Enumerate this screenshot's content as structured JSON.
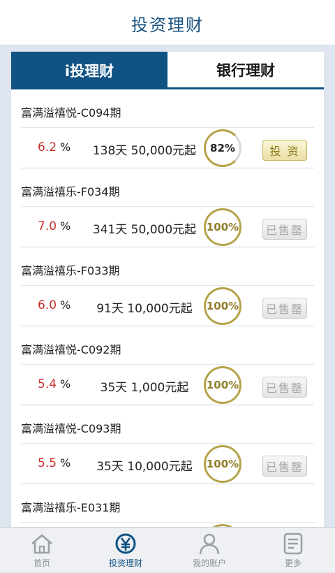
{
  "header": {
    "title": "投资理财"
  },
  "tabs": [
    {
      "label": "i投理财",
      "active": true
    },
    {
      "label": "银行理财",
      "active": false
    }
  ],
  "products": [
    {
      "name": "富满溢禧悦-C094期",
      "rate": "6.2",
      "rate_unit": "%",
      "terms": "138天 50,000元起",
      "progress": "82%",
      "action": "投 资",
      "status": "invest"
    },
    {
      "name": "富满溢禧乐-F034期",
      "rate": "7.0",
      "rate_unit": "%",
      "terms": "341天 50,000元起",
      "progress": "100%",
      "action": "已售罄",
      "status": "soldout"
    },
    {
      "name": "富满溢禧乐-F033期",
      "rate": "6.0",
      "rate_unit": "%",
      "terms": "91天 10,000元起",
      "progress": "100%",
      "action": "已售罄",
      "status": "soldout"
    },
    {
      "name": "富满溢禧悦-C092期",
      "rate": "5.4",
      "rate_unit": "%",
      "terms": "35天 1,000元起",
      "progress": "100%",
      "action": "已售罄",
      "status": "soldout"
    },
    {
      "name": "富满溢禧悦-C093期",
      "rate": "5.5",
      "rate_unit": "%",
      "terms": "35天 10,000元起",
      "progress": "100%",
      "action": "已售罄",
      "status": "soldout"
    },
    {
      "name": "富满溢禧乐-E031期",
      "rate": "",
      "rate_unit": "",
      "terms": "",
      "progress": "",
      "action": "",
      "status": "partial"
    }
  ],
  "bottom_nav": [
    {
      "label": "首页",
      "icon": "home-icon",
      "active": false
    },
    {
      "label": "投资理财",
      "icon": "yen-icon",
      "active": true
    },
    {
      "label": "我的账户",
      "icon": "user-icon",
      "active": false
    },
    {
      "label": "更多",
      "icon": "more-icon",
      "active": false
    }
  ],
  "colors": {
    "brand": "#0f5283",
    "rate": "#c9302c",
    "ring": "#b5a34a",
    "invest_button": "#e9dfa4"
  }
}
